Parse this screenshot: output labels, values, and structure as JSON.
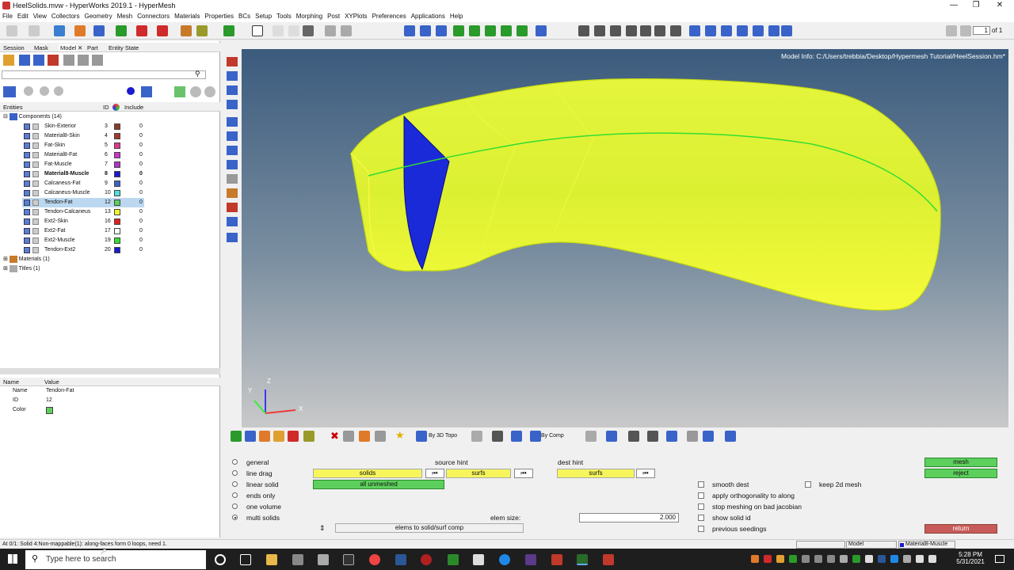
{
  "window": {
    "title": "HeelSolids.mvw - HyperWorks 2019.1 - HyperMesh"
  },
  "menu": [
    "File",
    "Edit",
    "View",
    "Collectors",
    "Geometry",
    "Mesh",
    "Connectors",
    "Materials",
    "Properties",
    "BCs",
    "Setup",
    "Tools",
    "Morphing",
    "Post",
    "XYPlots",
    "Preferences",
    "Applications",
    "Help"
  ],
  "page_box": {
    "value": "1",
    "of": "of 1"
  },
  "tabs": [
    "Session",
    "Mask",
    "Model",
    "Part",
    "Entity State"
  ],
  "active_tab": "Model",
  "entities_header": {
    "entities": "Entities",
    "id": "ID",
    "include": "Include"
  },
  "tree": {
    "components_label": "Components (14)",
    "components": [
      {
        "name": "Skin-Exterior",
        "id": "3",
        "include": "0",
        "color": "#8b3a2a"
      },
      {
        "name": "Material8-Skin",
        "id": "4",
        "include": "0",
        "color": "#a23b2b"
      },
      {
        "name": "Fat-Skin",
        "id": "5",
        "include": "0",
        "color": "#e0398a"
      },
      {
        "name": "Material8-Fat",
        "id": "6",
        "include": "0",
        "color": "#cc33cc"
      },
      {
        "name": "Fat-Muscle",
        "id": "7",
        "include": "0",
        "color": "#b034c8"
      },
      {
        "name": "Material8-Muscle",
        "id": "8",
        "include": "0",
        "color": "#1a1ad0",
        "bold": true
      },
      {
        "name": "Calcaneus-Fat",
        "id": "9",
        "include": "0",
        "color": "#3a63c9"
      },
      {
        "name": "Calcaneus-Muscle",
        "id": "10",
        "include": "0",
        "color": "#4ee0e0"
      },
      {
        "name": "Tendon-Fat",
        "id": "12",
        "include": "0",
        "color": "#5dcf5d",
        "selected": true
      },
      {
        "name": "Tendon-Calcaneus",
        "id": "13",
        "include": "0",
        "color": "#f2f22a"
      },
      {
        "name": "Ext2-Skin",
        "id": "16",
        "include": "0",
        "color": "#e02020"
      },
      {
        "name": "Ext2-Fat",
        "id": "17",
        "include": "0",
        "color": "#ffffff"
      },
      {
        "name": "Ext2-Muscle",
        "id": "19",
        "include": "0",
        "color": "#33e033"
      },
      {
        "name": "Tendon-Ext2",
        "id": "20",
        "include": "0",
        "color": "#1a1ad0"
      }
    ],
    "materials_label": "Materials (1)",
    "titles_label": "Titles (1)"
  },
  "properties": {
    "header_name": "Name",
    "header_value": "Value",
    "rows": [
      {
        "name": "Name",
        "value": "Tendon-Fat"
      },
      {
        "name": "ID",
        "value": "12"
      },
      {
        "name": "Color",
        "value": ""
      }
    ],
    "color": "#5dcf5d"
  },
  "viewport": {
    "model_info": "Model Info: C:/Users/trebbia/Desktop/Hypermesh Tutorial/HeelSession.hm*",
    "axis": {
      "x": "X",
      "y": "Y",
      "z": "Z"
    }
  },
  "bottom_toolbar": {
    "topo": "By 3D Topo",
    "comp": "By Comp"
  },
  "panel": {
    "modes": [
      {
        "label": "general",
        "on": false
      },
      {
        "label": "line drag",
        "on": false
      },
      {
        "label": "linear solid",
        "on": false
      },
      {
        "label": "ends only",
        "on": false
      },
      {
        "label": "one volume",
        "on": false
      },
      {
        "label": "multi solids",
        "on": true
      }
    ],
    "solids": "solids",
    "all_unmeshed": "all unmeshed",
    "source_hint": "source hint",
    "source_surfs": "surfs",
    "dest_hint": "dest hint",
    "dest_surfs": "surfs",
    "elem_size_label": "elem size:",
    "elem_size": "2.000",
    "elems_to": "elems to solid/surf comp",
    "options": [
      {
        "label": "smooth dest",
        "checked": false
      },
      {
        "label": "apply orthogonality to along",
        "checked": false
      },
      {
        "label": "stop meshing on bad jacobian",
        "checked": false
      },
      {
        "label": "show solid id",
        "checked": false
      },
      {
        "label": "previous seedings",
        "checked": false
      }
    ],
    "keep_2d": "keep 2d mesh",
    "mesh": "mesh",
    "reject": "reject",
    "return": "return"
  },
  "status": {
    "message": "At 0/1: Solid 4:Non-mappable(1): along-faces form 0 loops, need 1.",
    "model": "Model",
    "component": "Material8-Muscle"
  },
  "taskbar": {
    "search": "Type here to search",
    "time": "5:28 PM",
    "date": "5/31/2021"
  }
}
